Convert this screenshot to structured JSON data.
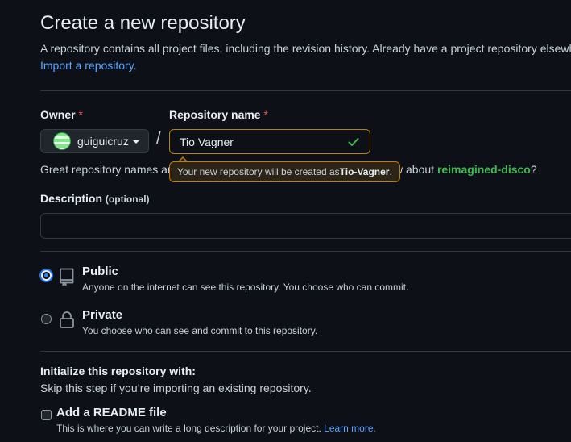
{
  "page": {
    "title": "Create a new repository",
    "subtitle": "A repository contains all project files, including the revision history. Already have a project repository elsewhere?",
    "import_link": "Import a repository."
  },
  "owner": {
    "label": "Owner",
    "required_mark": "*",
    "name": "guiguicruz",
    "slash": "/"
  },
  "repo": {
    "label": "Repository name",
    "required_mark": "*",
    "value": "Tio Vagner",
    "tooltip_prefix": "Your new repository will be created as ",
    "tooltip_name": "Tio-Vagner",
    "tooltip_suffix": "."
  },
  "suggestion": {
    "prefix": "Great repository names ar",
    "end_prefix": "w about ",
    "name": "reimagined-disco",
    "end_suffix": "?"
  },
  "description": {
    "label": "Description",
    "optional": "(optional)",
    "value": ""
  },
  "visibility": {
    "selected": "public",
    "public": {
      "title": "Public",
      "desc": "Anyone on the internet can see this repository. You choose who can commit."
    },
    "private": {
      "title": "Private",
      "desc": "You choose who can see and commit to this repository."
    }
  },
  "initialize": {
    "title": "Initialize this repository with:",
    "subtitle": "Skip this step if you’re importing an existing repository.",
    "readme": {
      "title": "Add a README file",
      "desc": "This is where you can write a long description for your project. ",
      "learn_more": "Learn more.",
      "checked": false
    }
  },
  "icons": {
    "valid": "check-icon",
    "public": "repo-icon",
    "private": "lock-icon",
    "owner_menu": "chevron-down-icon"
  },
  "colors": {
    "background": "#0d1117",
    "accent_link": "#58a6ff",
    "success": "#3fb950",
    "warning_border": "#bb8009",
    "required": "#f85149"
  }
}
